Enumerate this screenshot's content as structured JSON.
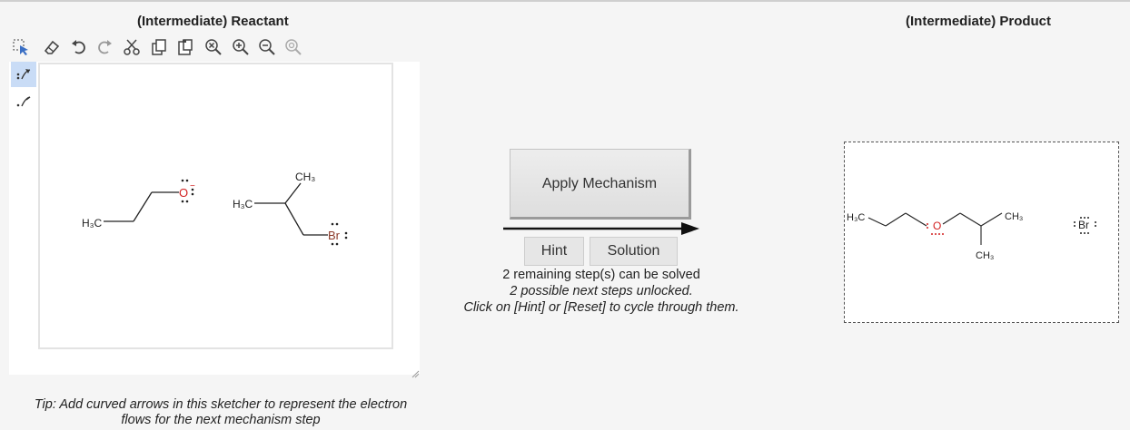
{
  "reactant_panel": {
    "title": "(Intermediate) Reactant"
  },
  "product_panel": {
    "title": "(Intermediate) Product"
  },
  "toolbar": {
    "tools": [
      "select-icon",
      "eraser-icon",
      "undo-icon",
      "redo-icon",
      "cut-icon",
      "copy-icon",
      "paste-icon",
      "clear-icon",
      "zoom-in-icon",
      "zoom-out-icon",
      "zoom-reset-icon"
    ]
  },
  "sidebar": {
    "tools": [
      "curved-arrow-pair-icon",
      "curved-arrow-single-icon"
    ],
    "active": 0
  },
  "reactant": {
    "molecule1": {
      "methyl": "H₃C",
      "oxygen": "O",
      "charge": "−"
    },
    "molecule2": {
      "methyl_top": "CH₃",
      "methyl_left": "H₃C",
      "bromine": "Br"
    }
  },
  "actions": {
    "apply_label": "Apply Mechanism",
    "hint_label": "Hint",
    "solution_label": "Solution"
  },
  "status": {
    "line1": "2 remaining step(s) can be solved",
    "line2": "2 possible next steps unlocked.",
    "line3": "Click on [Hint] or [Reset] to cycle through them."
  },
  "tip": {
    "line1": "Tip: Add curved arrows in this sketcher to represent the electron",
    "line2": "flows for the next mechanism step"
  },
  "product": {
    "methyl_left": "H₃C",
    "oxygen": "O",
    "methyl_top": "CH₃",
    "methyl_bottom": "CH₃",
    "bromine": "Br"
  },
  "colors": {
    "oxygen": "#d22020",
    "bromine": "#8b3a2a",
    "active_tool": "#c9dcf6"
  }
}
